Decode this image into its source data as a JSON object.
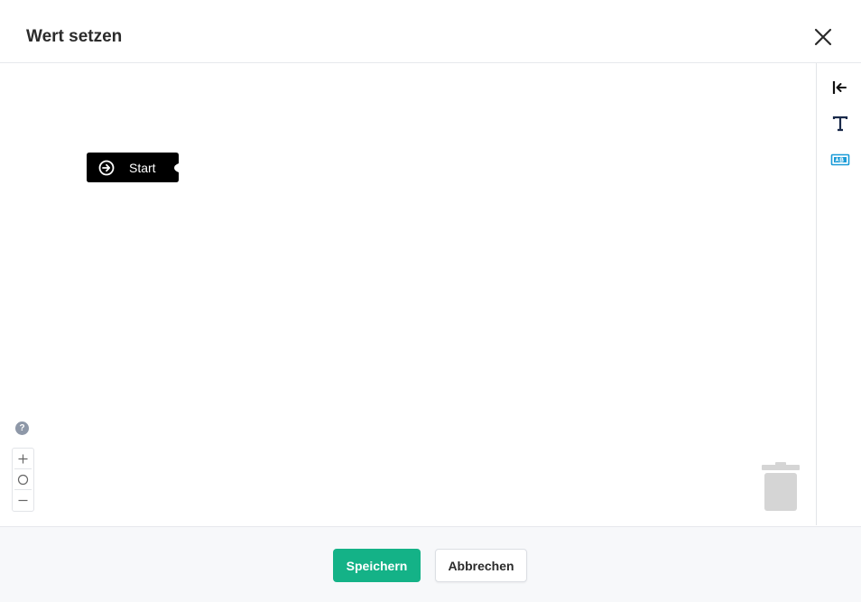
{
  "dialog": {
    "title": "Wert setzen"
  },
  "canvas": {
    "start_block": {
      "label": "Start"
    },
    "help_label": "?"
  },
  "toolbox": {
    "tools": [
      {
        "name": "collapse-panel-icon"
      },
      {
        "name": "text-icon"
      },
      {
        "name": "text-field-icon"
      }
    ]
  },
  "footer": {
    "save_label": "Speichern",
    "cancel_label": "Abbrechen"
  },
  "colors": {
    "primary": "#14b287",
    "toolbox_text_icon": "#1a2a4a",
    "toolbox_field_icon": "#1a9bd7",
    "block": "#000000"
  }
}
